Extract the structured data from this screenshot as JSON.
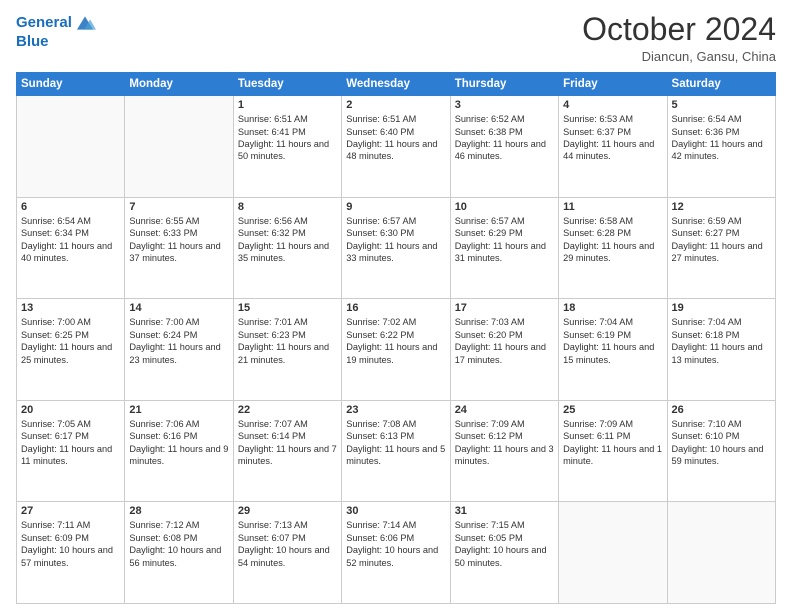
{
  "header": {
    "logo_line1": "General",
    "logo_line2": "Blue",
    "month": "October 2024",
    "location": "Diancun, Gansu, China"
  },
  "days": [
    "Sunday",
    "Monday",
    "Tuesday",
    "Wednesday",
    "Thursday",
    "Friday",
    "Saturday"
  ],
  "weeks": [
    [
      {
        "day": "",
        "content": ""
      },
      {
        "day": "",
        "content": ""
      },
      {
        "day": "1",
        "content": "Sunrise: 6:51 AM\nSunset: 6:41 PM\nDaylight: 11 hours and 50 minutes."
      },
      {
        "day": "2",
        "content": "Sunrise: 6:51 AM\nSunset: 6:40 PM\nDaylight: 11 hours and 48 minutes."
      },
      {
        "day": "3",
        "content": "Sunrise: 6:52 AM\nSunset: 6:38 PM\nDaylight: 11 hours and 46 minutes."
      },
      {
        "day": "4",
        "content": "Sunrise: 6:53 AM\nSunset: 6:37 PM\nDaylight: 11 hours and 44 minutes."
      },
      {
        "day": "5",
        "content": "Sunrise: 6:54 AM\nSunset: 6:36 PM\nDaylight: 11 hours and 42 minutes."
      }
    ],
    [
      {
        "day": "6",
        "content": "Sunrise: 6:54 AM\nSunset: 6:34 PM\nDaylight: 11 hours and 40 minutes."
      },
      {
        "day": "7",
        "content": "Sunrise: 6:55 AM\nSunset: 6:33 PM\nDaylight: 11 hours and 37 minutes."
      },
      {
        "day": "8",
        "content": "Sunrise: 6:56 AM\nSunset: 6:32 PM\nDaylight: 11 hours and 35 minutes."
      },
      {
        "day": "9",
        "content": "Sunrise: 6:57 AM\nSunset: 6:30 PM\nDaylight: 11 hours and 33 minutes."
      },
      {
        "day": "10",
        "content": "Sunrise: 6:57 AM\nSunset: 6:29 PM\nDaylight: 11 hours and 31 minutes."
      },
      {
        "day": "11",
        "content": "Sunrise: 6:58 AM\nSunset: 6:28 PM\nDaylight: 11 hours and 29 minutes."
      },
      {
        "day": "12",
        "content": "Sunrise: 6:59 AM\nSunset: 6:27 PM\nDaylight: 11 hours and 27 minutes."
      }
    ],
    [
      {
        "day": "13",
        "content": "Sunrise: 7:00 AM\nSunset: 6:25 PM\nDaylight: 11 hours and 25 minutes."
      },
      {
        "day": "14",
        "content": "Sunrise: 7:00 AM\nSunset: 6:24 PM\nDaylight: 11 hours and 23 minutes."
      },
      {
        "day": "15",
        "content": "Sunrise: 7:01 AM\nSunset: 6:23 PM\nDaylight: 11 hours and 21 minutes."
      },
      {
        "day": "16",
        "content": "Sunrise: 7:02 AM\nSunset: 6:22 PM\nDaylight: 11 hours and 19 minutes."
      },
      {
        "day": "17",
        "content": "Sunrise: 7:03 AM\nSunset: 6:20 PM\nDaylight: 11 hours and 17 minutes."
      },
      {
        "day": "18",
        "content": "Sunrise: 7:04 AM\nSunset: 6:19 PM\nDaylight: 11 hours and 15 minutes."
      },
      {
        "day": "19",
        "content": "Sunrise: 7:04 AM\nSunset: 6:18 PM\nDaylight: 11 hours and 13 minutes."
      }
    ],
    [
      {
        "day": "20",
        "content": "Sunrise: 7:05 AM\nSunset: 6:17 PM\nDaylight: 11 hours and 11 minutes."
      },
      {
        "day": "21",
        "content": "Sunrise: 7:06 AM\nSunset: 6:16 PM\nDaylight: 11 hours and 9 minutes."
      },
      {
        "day": "22",
        "content": "Sunrise: 7:07 AM\nSunset: 6:14 PM\nDaylight: 11 hours and 7 minutes."
      },
      {
        "day": "23",
        "content": "Sunrise: 7:08 AM\nSunset: 6:13 PM\nDaylight: 11 hours and 5 minutes."
      },
      {
        "day": "24",
        "content": "Sunrise: 7:09 AM\nSunset: 6:12 PM\nDaylight: 11 hours and 3 minutes."
      },
      {
        "day": "25",
        "content": "Sunrise: 7:09 AM\nSunset: 6:11 PM\nDaylight: 11 hours and 1 minute."
      },
      {
        "day": "26",
        "content": "Sunrise: 7:10 AM\nSunset: 6:10 PM\nDaylight: 10 hours and 59 minutes."
      }
    ],
    [
      {
        "day": "27",
        "content": "Sunrise: 7:11 AM\nSunset: 6:09 PM\nDaylight: 10 hours and 57 minutes."
      },
      {
        "day": "28",
        "content": "Sunrise: 7:12 AM\nSunset: 6:08 PM\nDaylight: 10 hours and 56 minutes."
      },
      {
        "day": "29",
        "content": "Sunrise: 7:13 AM\nSunset: 6:07 PM\nDaylight: 10 hours and 54 minutes."
      },
      {
        "day": "30",
        "content": "Sunrise: 7:14 AM\nSunset: 6:06 PM\nDaylight: 10 hours and 52 minutes."
      },
      {
        "day": "31",
        "content": "Sunrise: 7:15 AM\nSunset: 6:05 PM\nDaylight: 10 hours and 50 minutes."
      },
      {
        "day": "",
        "content": ""
      },
      {
        "day": "",
        "content": ""
      }
    ]
  ]
}
